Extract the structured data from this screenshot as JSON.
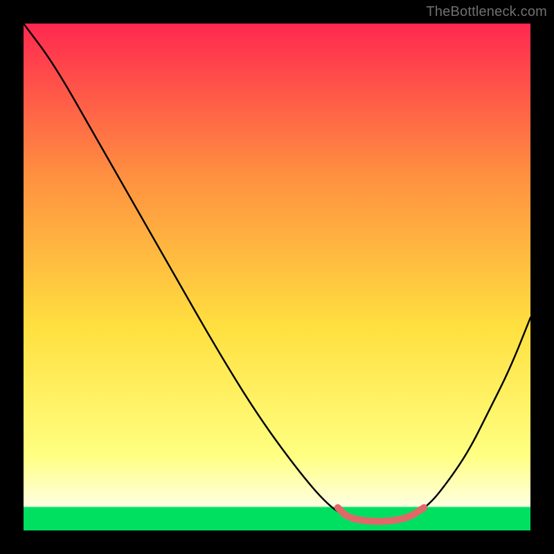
{
  "watermark": "TheBottleneck.com",
  "chart_data": {
    "type": "line",
    "title": "",
    "xlabel": "",
    "ylabel": "",
    "xlim": [
      0,
      100
    ],
    "ylim": [
      0,
      100
    ],
    "grid": false,
    "legend": false,
    "background_gradient": {
      "top_color": "#ff2850",
      "mid_upper_color": "#ff9040",
      "mid_lower_color": "#ffe040",
      "lower_color": "#ffff80",
      "bottom_color": "#00e060"
    },
    "series": [
      {
        "name": "main-curve",
        "color": "#000000",
        "x": [
          0,
          6,
          14,
          22,
          30,
          38,
          46,
          54,
          60,
          64,
          68,
          72,
          76,
          80,
          84,
          88,
          92,
          96,
          100
        ],
        "y": [
          100,
          92,
          78,
          64,
          50,
          36,
          23,
          12,
          5,
          2.5,
          1.8,
          1.8,
          2.5,
          5,
          10,
          16,
          24,
          32,
          42
        ]
      },
      {
        "name": "highlight-curve",
        "color": "#e06868",
        "x": [
          62,
          64,
          68,
          72,
          76,
          79
        ],
        "y": [
          4.5,
          2.5,
          1.8,
          1.8,
          2.5,
          4.5
        ]
      }
    ]
  }
}
